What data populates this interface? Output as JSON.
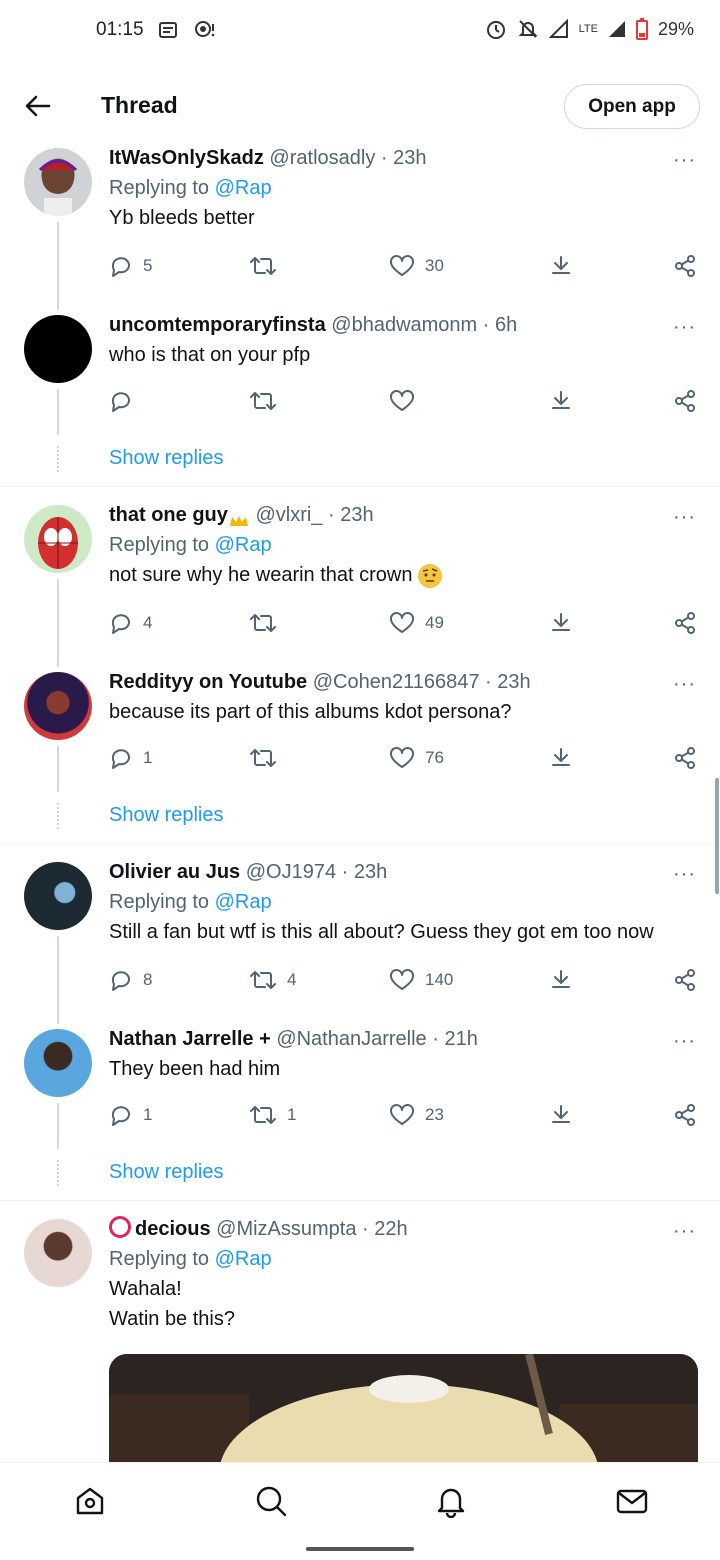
{
  "status_bar": {
    "time": "01:15",
    "battery": "29%",
    "network": "LTE"
  },
  "header": {
    "title": "Thread",
    "open_app": "Open app"
  },
  "tweets": [
    {
      "name": "ItWasOnlySkadz",
      "handle": "@ratlosadly",
      "time": "· 23h",
      "replying_prefix": "Replying to",
      "replying_to": "@Rap",
      "text": "Yb bleeds better",
      "replies": "5",
      "retweets": "",
      "likes": "30"
    },
    {
      "name": "uncomtemporaryfinsta",
      "handle": "@bhadwamonm",
      "time": "· 6h",
      "text": "who is that on your pfp",
      "replies": "",
      "retweets": "",
      "likes": ""
    },
    {
      "name": "that one guy",
      "handle": "@vlxri_",
      "time": "· 23h",
      "replying_prefix": "Replying to",
      "replying_to": "@Rap",
      "text": "not sure why he wearin that crown",
      "replies": "4",
      "retweets": "",
      "likes": "49"
    },
    {
      "name": "Reddityy on Youtube",
      "handle": "@Cohen21166847",
      "time": "· 23h",
      "text": "because its part of this albums kdot persona?",
      "replies": "1",
      "retweets": "",
      "likes": "76"
    },
    {
      "name": "Olivier au Jus",
      "handle": "@OJ1974",
      "time": "· 23h",
      "replying_prefix": "Replying to",
      "replying_to": "@Rap",
      "text": "Still a fan but wtf is this all about?  Guess they got em too now",
      "replies": "8",
      "retweets": "4",
      "likes": "140"
    },
    {
      "name": "Nathan Jarrelle +",
      "handle": "@NathanJarrelle",
      "time": "· 21h",
      "text": "They been had him",
      "replies": "1",
      "retweets": "1",
      "likes": "23"
    },
    {
      "name": "decious",
      "handle": "@MizAssumpta",
      "time": "· 22h",
      "replying_prefix": "Replying to",
      "replying_to": "@Rap",
      "text": "Wahala!\nWatin be this?"
    }
  ],
  "show_replies": "Show replies",
  "more": "···",
  "icons": {
    "reply": "reply-icon",
    "retweet": "retweet-icon",
    "like": "heart-icon",
    "share_down": "download-share-icon",
    "share": "share-icon",
    "back": "back-arrow-icon",
    "home": "home-icon",
    "search": "search-icon",
    "notifications": "bell-icon",
    "messages": "mail-icon"
  },
  "colors": {
    "link": "#1d9bf0",
    "secondary": "#536471",
    "text": "#0f1419"
  }
}
